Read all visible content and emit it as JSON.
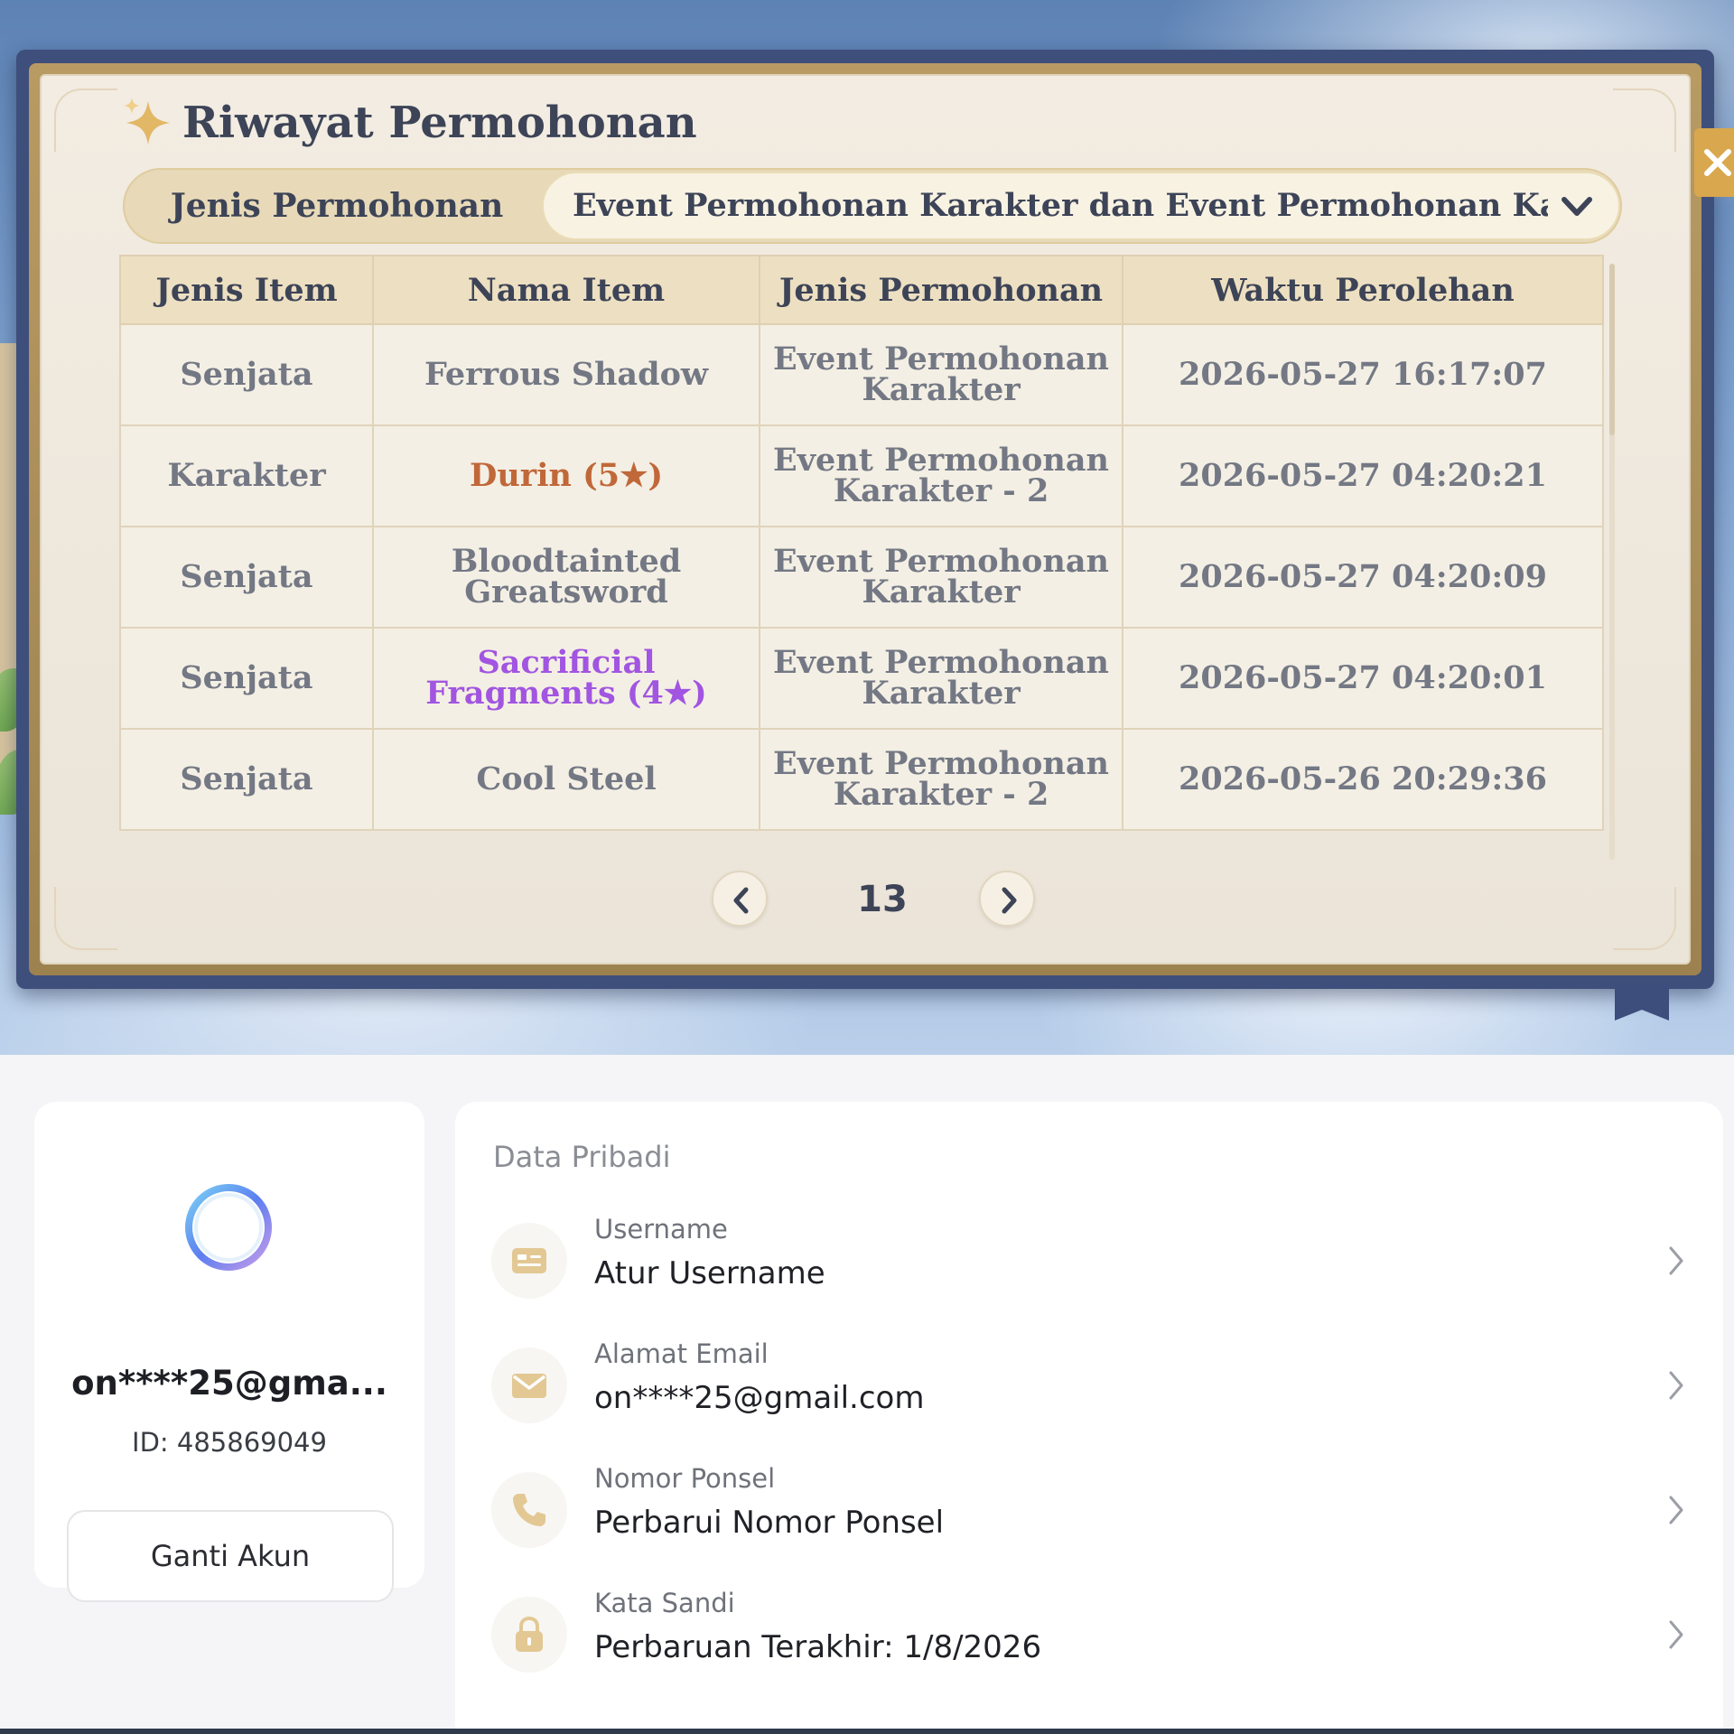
{
  "wish_history": {
    "title": "Riwayat Permohonan",
    "filter_label": "Jenis Permohonan",
    "filter_value": "Event Permohonan Karakter dan Event Permohonan Kar···",
    "columns": [
      "Jenis Item",
      "Nama Item",
      "Jenis Permohonan",
      "Waktu Perolehan"
    ],
    "rows": [
      {
        "item_type": "Senjata",
        "item_name": "Ferrous Shadow",
        "wish_type": "Event Permohonan Karakter",
        "time": "2026-05-27 16:17:07"
      },
      {
        "item_type": "Karakter",
        "item_name": "Durin (5★)",
        "wish_type": "Event Permohonan Karakter - 2",
        "time": "2026-05-27 04:20:21"
      },
      {
        "item_type": "Senjata",
        "item_name": "Bloodtainted Greatsword",
        "wish_type": "Event Permohonan Karakter",
        "time": "2026-05-27 04:20:09"
      },
      {
        "item_type": "Senjata",
        "item_name": "Sacrificial Fragments (4★)",
        "wish_type": "Event Permohonan Karakter",
        "time": "2026-05-27 04:20:01"
      },
      {
        "item_type": "Senjata",
        "item_name": "Cool Steel",
        "wish_type": "Event Permohonan Karakter - 2",
        "time": "2026-05-26 20:29:36"
      }
    ],
    "page": "13",
    "icons": {
      "title": "sparkle-icon",
      "dropdown": "chevron-down-icon",
      "prev": "chevron-left-icon",
      "next": "chevron-right-icon",
      "close": "close-icon"
    },
    "colors": {
      "five_star": "#c0683a",
      "four_star": "#a155e0",
      "three_star": "#737884",
      "frame": "#3f4f7c",
      "gold": "#d9a74e"
    }
  },
  "account": {
    "email_short": "on****25@gma...",
    "id_text": "ID: 485869049",
    "switch_label": "Ganti Akun",
    "section_title": "Data Pribadi",
    "rows": [
      {
        "label": "Username",
        "value": "Atur Username",
        "icon": "id-card-icon"
      },
      {
        "label": "Alamat Email",
        "value": "on****25@gmail.com",
        "icon": "mail-icon"
      },
      {
        "label": "Nomor Ponsel",
        "value": "Perbarui Nomor Ponsel",
        "icon": "phone-icon"
      },
      {
        "label": "Kata Sandi",
        "value": "Perbaruan Terakhir: 1/8/2026",
        "icon": "lock-icon"
      }
    ],
    "colors": {
      "icon": "#e3c894",
      "text": "#1f2126",
      "label": "#6f727a"
    }
  }
}
